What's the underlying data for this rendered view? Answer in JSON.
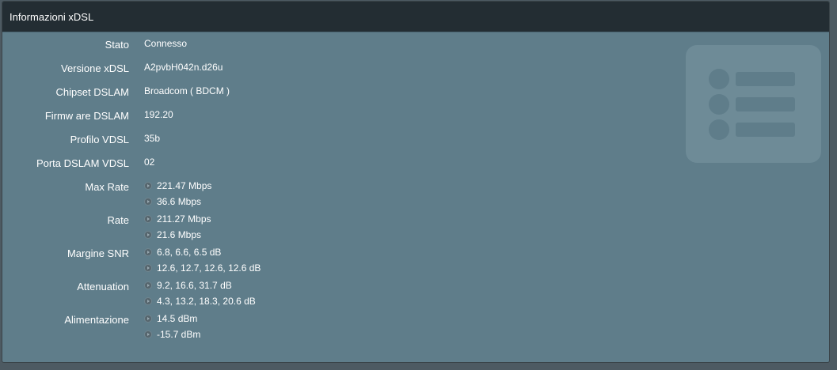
{
  "panel": {
    "title": "Informazioni xDSL"
  },
  "rows": {
    "stato": {
      "label": "Stato",
      "value": "Connesso"
    },
    "versione": {
      "label": "Versione xDSL",
      "value": "A2pvbH042n.d26u"
    },
    "chipset": {
      "label": "Chipset DSLAM",
      "value": "Broadcom ( BDCM )"
    },
    "firmware": {
      "label": "Firmw are DSLAM",
      "value": "192.20"
    },
    "profilo": {
      "label": "Profilo VDSL",
      "value": "35b"
    },
    "porta": {
      "label": "Porta DSLAM VDSL",
      "value": "02"
    },
    "max_rate": {
      "label": "Max Rate",
      "down": "221.47 Mbps",
      "up": "36.6 Mbps"
    },
    "rate": {
      "label": "Rate",
      "down": "211.27 Mbps",
      "up": "21.6 Mbps"
    },
    "snr": {
      "label": "Margine SNR",
      "down": "6.8, 6.6, 6.5 dB",
      "up": "12.6, 12.7, 12.6, 12.6 dB"
    },
    "attenuation": {
      "label": "Attenuation",
      "down": "9.2, 16.6, 31.7 dB",
      "up": "4.3, 13.2, 18.3, 20.6 dB"
    },
    "alimentazione": {
      "label": "Alimentazione",
      "down": "14.5 dBm",
      "up": "-15.7 dBm"
    }
  },
  "icons": {
    "bullet": "arrow-circle-icon",
    "decorative": "list-icon"
  },
  "colors": {
    "panel_bg": "#5f7d8a",
    "header_bg": "#232d33",
    "text": "#ffffff"
  }
}
